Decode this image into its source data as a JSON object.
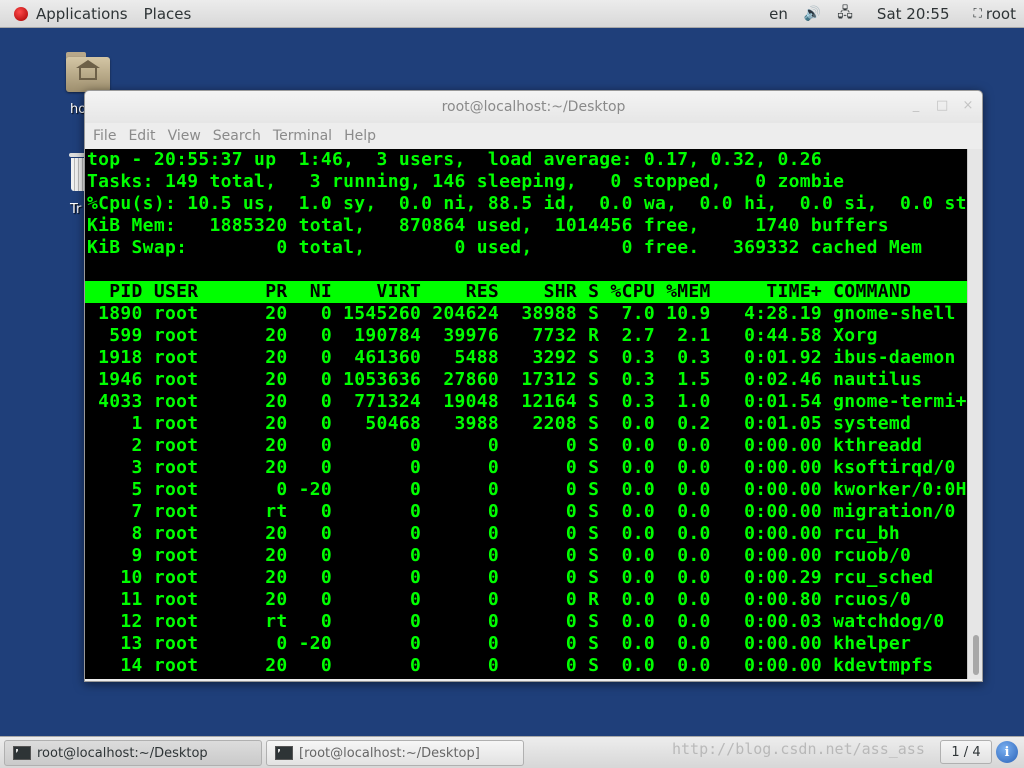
{
  "topbar": {
    "applications": "Applications",
    "places": "Places",
    "lang": "en",
    "clock": "Sat 20:55",
    "user": "root"
  },
  "desktop": {
    "home_label": "ho",
    "trash_label": "Tr"
  },
  "window": {
    "title": "root@localhost:~/Desktop",
    "controls": [
      "_",
      "□",
      "×"
    ],
    "menus": [
      "File",
      "Edit",
      "View",
      "Search",
      "Terminal",
      "Help"
    ]
  },
  "top_output": {
    "summary": [
      "top - 20:55:37 up  1:46,  3 users,  load average: 0.17, 0.32, 0.26",
      "Tasks: 149 total,   3 running, 146 sleeping,   0 stopped,   0 zombie",
      "%Cpu(s): 10.5 us,  1.0 sy,  0.0 ni, 88.5 id,  0.0 wa,  0.0 hi,  0.0 si,  0.0 st",
      "KiB Mem:   1885320 total,   870864 used,  1014456 free,     1740 buffers",
      "KiB Swap:        0 total,        0 used,        0 free.   369332 cached Mem"
    ],
    "header": "  PID USER      PR  NI    VIRT    RES    SHR S %CPU %MEM     TIME+ COMMAND",
    "rows": [
      " 1890 root      20   0 1545260 204624  38988 S  7.0 10.9   4:28.19 gnome-shell",
      "  599 root      20   0  190784  39976   7732 R  2.7  2.1   0:44.58 Xorg",
      " 1918 root      20   0  461360   5488   3292 S  0.3  0.3   0:01.92 ibus-daemon",
      " 1946 root      20   0 1053636  27860  17312 S  0.3  1.5   0:02.46 nautilus",
      " 4033 root      20   0  771324  19048  12164 S  0.3  1.0   0:01.54 gnome-termi+",
      "    1 root      20   0   50468   3988   2208 S  0.0  0.2   0:01.05 systemd",
      "    2 root      20   0       0      0      0 S  0.0  0.0   0:00.00 kthreadd",
      "    3 root      20   0       0      0      0 S  0.0  0.0   0:00.00 ksoftirqd/0",
      "    5 root       0 -20       0      0      0 S  0.0  0.0   0:00.00 kworker/0:0H",
      "    7 root      rt   0       0      0      0 S  0.0  0.0   0:00.00 migration/0",
      "    8 root      20   0       0      0      0 S  0.0  0.0   0:00.00 rcu_bh",
      "    9 root      20   0       0      0      0 S  0.0  0.0   0:00.00 rcuob/0",
      "   10 root      20   0       0      0      0 S  0.0  0.0   0:00.29 rcu_sched",
      "   11 root      20   0       0      0      0 R  0.0  0.0   0:00.80 rcuos/0",
      "   12 root      rt   0       0      0      0 S  0.0  0.0   0:00.03 watchdog/0",
      "   13 root       0 -20       0      0      0 S  0.0  0.0   0:00.00 khelper",
      "   14 root      20   0       0      0      0 S  0.0  0.0   0:00.00 kdevtmpfs"
    ]
  },
  "taskbar": {
    "task1": "root@localhost:~/Desktop",
    "task2": "[root@localhost:~/Desktop]",
    "watermark": "http://blog.csdn.net/ass_ass",
    "pager": "1 / 4",
    "info": "i"
  },
  "icons": {
    "applications": "redhat-icon",
    "volume": "volume-icon",
    "network": "network-icon",
    "user": "user-icon"
  }
}
